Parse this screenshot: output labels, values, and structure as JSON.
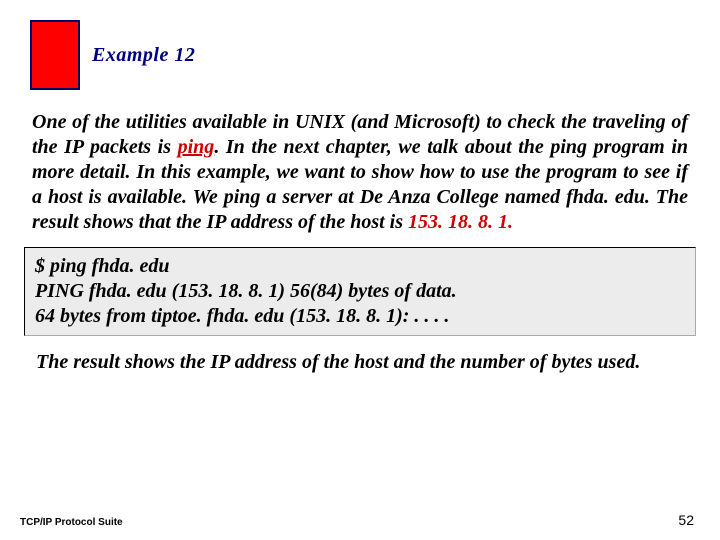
{
  "header": {
    "title": "Example 12"
  },
  "body": {
    "text_before_ping": "One of the utilities available in UNIX (and Microsoft) to check the traveling of the IP packets is ",
    "ping_word": "ping",
    "text_after_ping": ". In the next chapter, we talk about the ping program in more detail. In this example, we want to show how to use the program to see if a host is available. We ping a server at De Anza College named fhda. edu. The result shows that the IP address of the host is ",
    "ip_highlight": "153. 18. 8. 1.",
    "code_line1": "$ ping fhda. edu",
    "code_line2": "PING fhda. edu (153. 18. 8. 1) 56(84) bytes of data.",
    "code_line3": "64 bytes from tiptoe. fhda. edu (153. 18. 8. 1): . . . .",
    "after_text": "The result shows the IP address of the host and the number of bytes used."
  },
  "footer": {
    "left": "TCP/IP Protocol Suite",
    "page": "52"
  }
}
